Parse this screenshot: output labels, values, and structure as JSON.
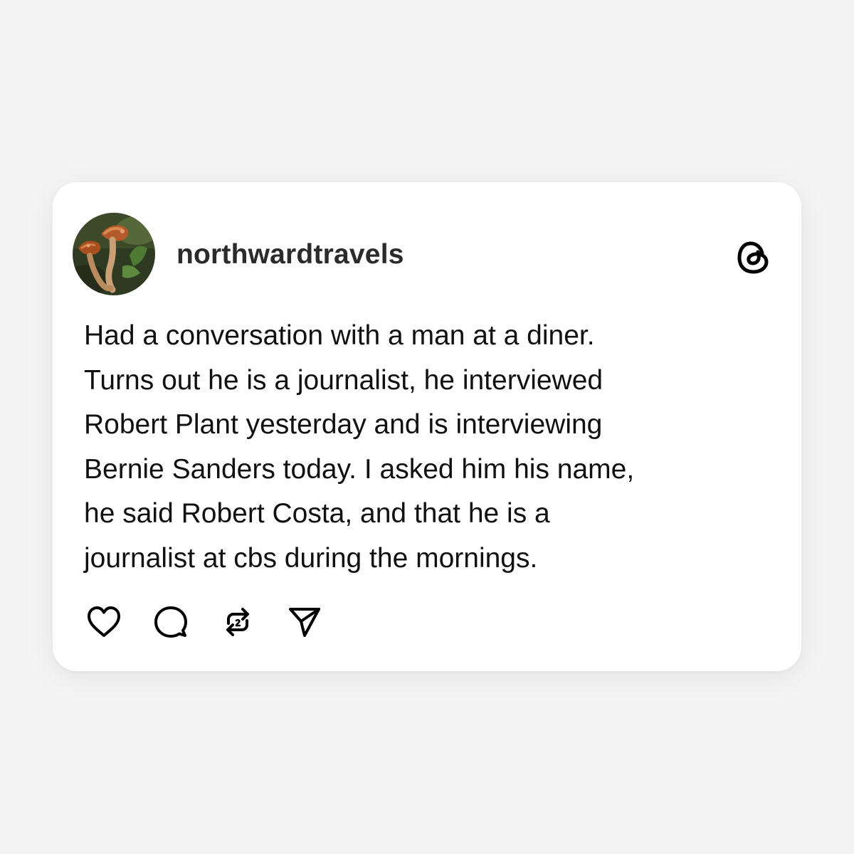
{
  "post": {
    "username": "northwardtravels",
    "text": "Had a conversation with a man at a diner.\nTurns out he is a journalist, he interviewed\nRobert Plant yesterday and is interviewing\nBernie Sanders today. I asked him his name,\nhe said Robert Costa, and that he is a\njournalist at cbs during the mornings.",
    "avatar": "mushroom-photo-avatar",
    "platform_icon": "threads-logo-icon"
  },
  "actions": [
    {
      "icon": "heart-icon",
      "label": "like"
    },
    {
      "icon": "comment-icon",
      "label": "reply"
    },
    {
      "icon": "repost-icon",
      "label": "repost"
    },
    {
      "icon": "send-icon",
      "label": "share"
    }
  ],
  "colors": {
    "background": "#f4f4f4",
    "card": "#ffffff",
    "text": "#111111",
    "username": "#2b2b2b"
  }
}
